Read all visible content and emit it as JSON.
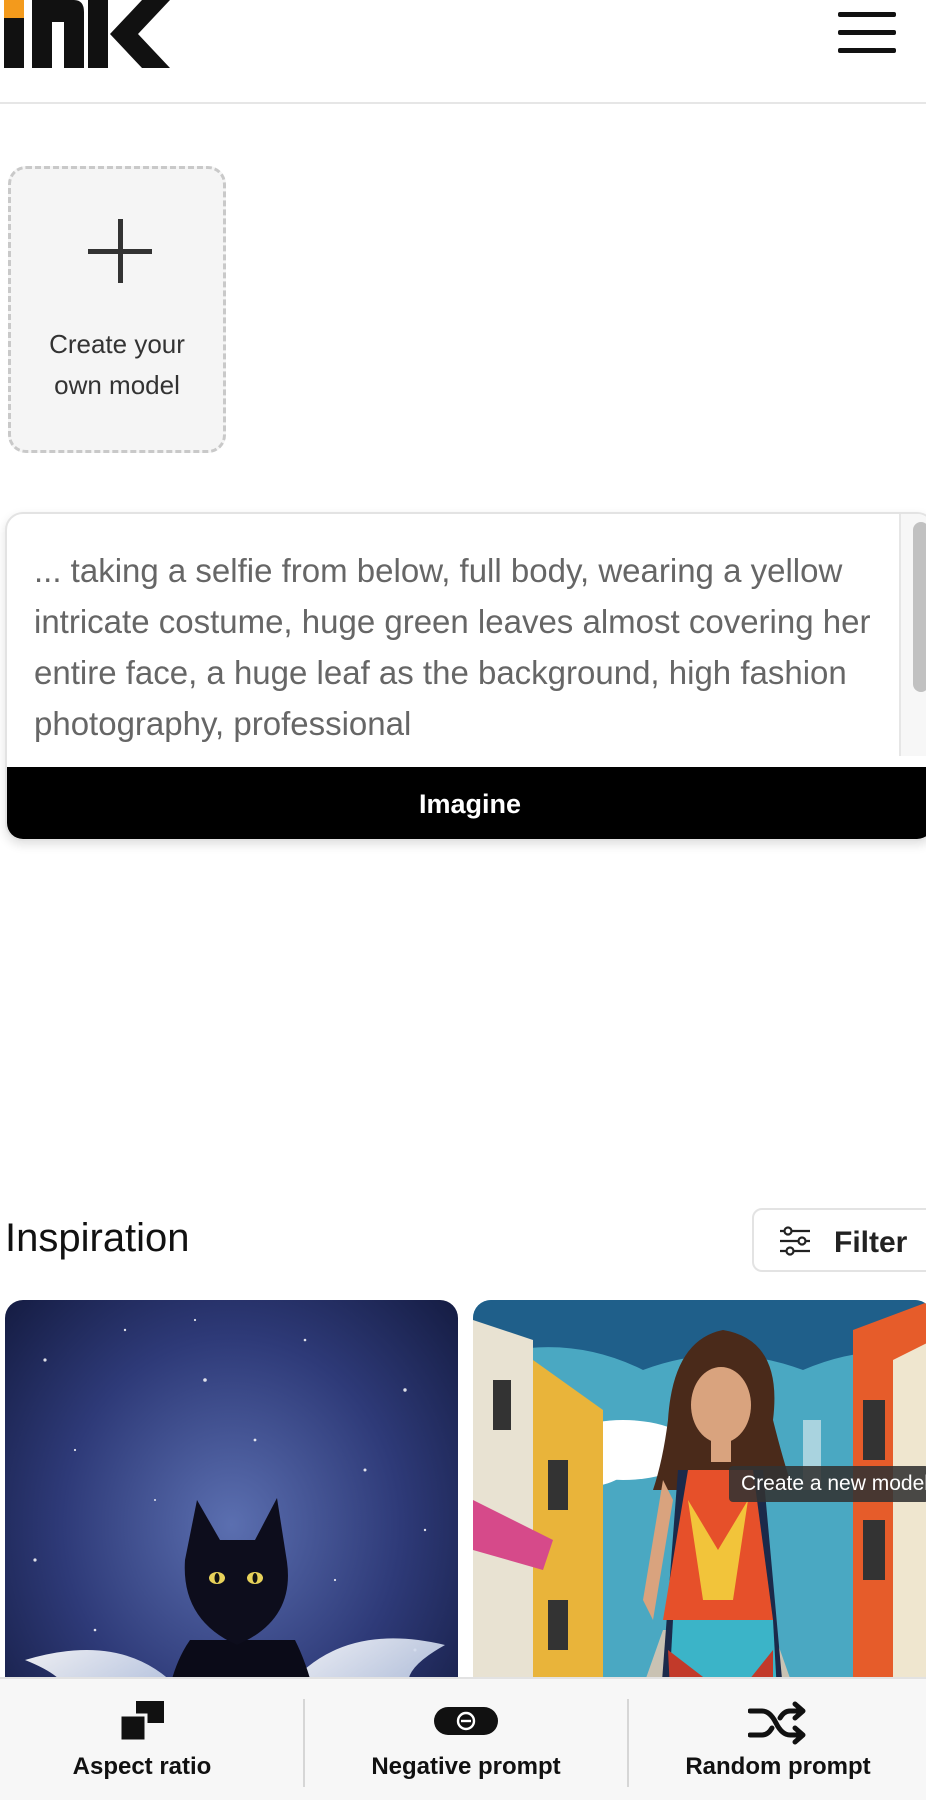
{
  "header": {
    "logo_alt": "mk",
    "menu_icon": "hamburger-menu-icon"
  },
  "create_model": {
    "label": "Create your own model",
    "icon": "plus-icon"
  },
  "prompt": {
    "text": "... taking a selfie from below, full body, wearing a yellow intricate costume, huge green leaves almost covering her entire face, a huge leaf as the background, high fashion photography, professional",
    "button_label": "Imagine"
  },
  "inspiration": {
    "title": "Inspiration",
    "filter_label": "Filter",
    "filter_icon": "sliders-icon",
    "cards": [
      {
        "subject": "black-cat-with-angel-wings"
      },
      {
        "subject": "pop-art-woman-in-street"
      }
    ],
    "tooltip": "Create a new model"
  },
  "bottom_bar": {
    "items": [
      {
        "label": "Aspect ratio",
        "icon": "aspect-ratio-icon"
      },
      {
        "label": "Negative prompt",
        "icon": "negative-prompt-icon"
      },
      {
        "label": "Random prompt",
        "icon": "shuffle-icon"
      }
    ]
  },
  "colors": {
    "accent": "#f39a1c",
    "primary": "#000000",
    "background": "#ffffff"
  }
}
